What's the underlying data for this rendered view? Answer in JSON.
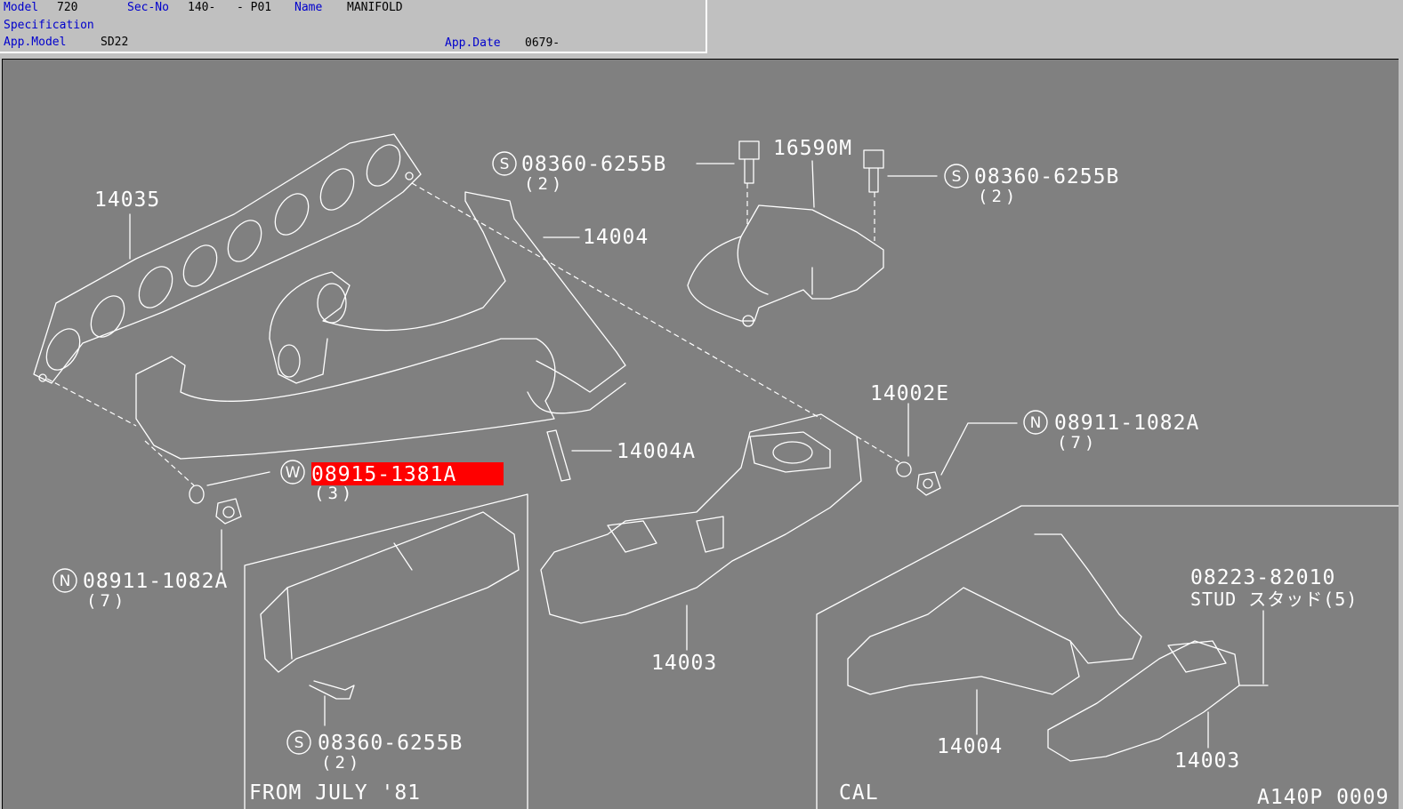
{
  "header": {
    "model_label": "Model",
    "model_value": "720",
    "secno_label": "Sec-No",
    "secno_value": "140-",
    "secno_suffix": "- P01",
    "name_label": "Name",
    "name_value": "MANIFOLD",
    "spec_label": "Specification",
    "appmodel_label": "App.Model",
    "appmodel_value": "SD22",
    "appdate_label": "App.Date",
    "appdate_value": "0679-"
  },
  "diagram": {
    "callouts": {
      "p14035": "14035",
      "p14004": "14004",
      "p16590m": "16590M",
      "bolt_top_left": "08360-6255B",
      "bolt_top_left_qty": "(2)",
      "bolt_top_right": "08360-6255B",
      "bolt_top_right_qty": "(2)",
      "p14002e": "14002E",
      "nut_right": "08911-1082A",
      "nut_right_qty": "(7)",
      "p14004a": "14004A",
      "washer_selected": "08915-1381A",
      "washer_qty": "(3)",
      "nut_left": "08911-1082A",
      "nut_left_qty": "(7)",
      "p14003": "14003",
      "bolt_inset": "08360-6255B",
      "bolt_inset_qty": "(2)",
      "stud": "08223-82010",
      "stud_desc": "STUD スタッド(5)",
      "cal_14004": "14004",
      "cal_14003": "14003"
    },
    "symbols": {
      "s": "S",
      "n": "N",
      "w": "W"
    },
    "inset_caption": "FROM JULY '81",
    "cal_caption": "CAL",
    "drawing_code": "A140P 0009"
  },
  "colors": {
    "highlight": "#ff0000",
    "label_blue": "#0000cc",
    "drawing_bg": "#808080",
    "line": "#ffffff"
  }
}
